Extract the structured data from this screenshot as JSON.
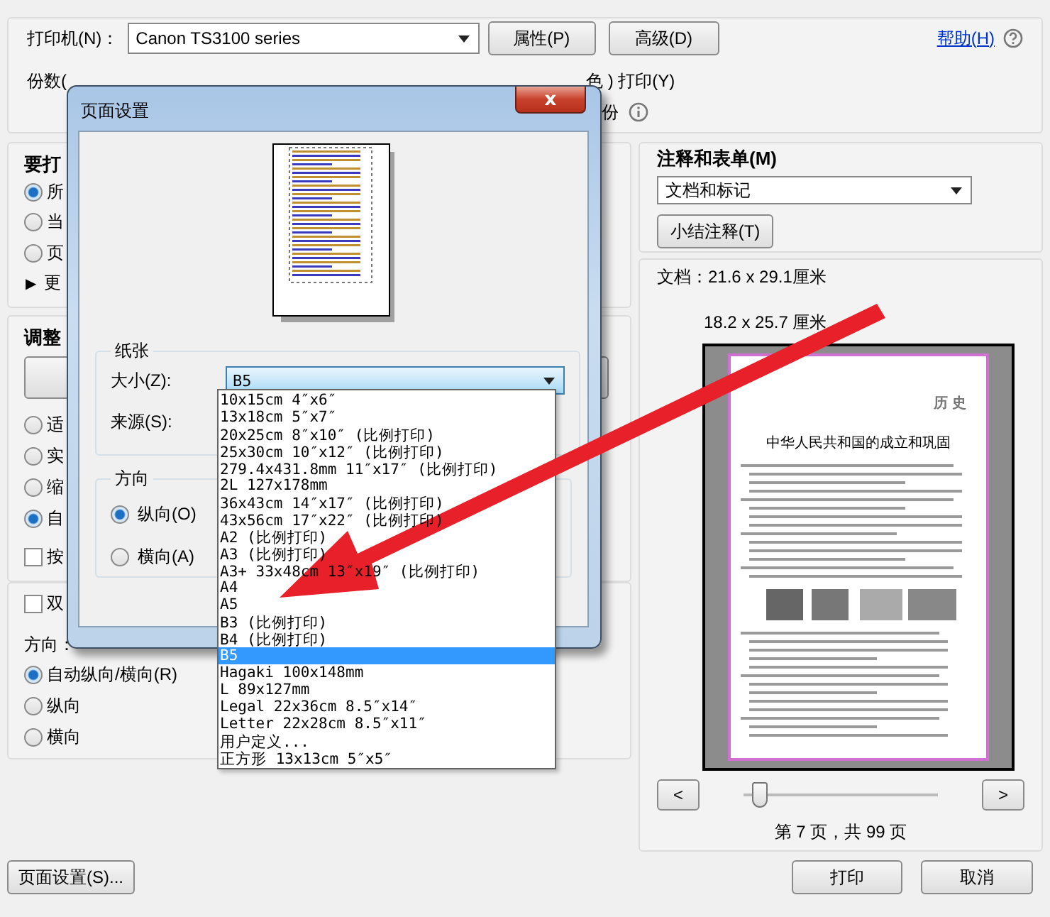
{
  "print_dialog": {
    "printer": {
      "label": "打印机(N)：",
      "value": "Canon TS3100 series"
    },
    "top_buttons": [
      "属性(P)",
      "高级(D)"
    ],
    "help_link": "帮助(H)",
    "copies_label": "份数(",
    "grayscale_label": "色 ) 打印(Y)",
    "copies_suffix": "份",
    "pages_section": {
      "title": "要打",
      "options": [
        {
          "label": "所",
          "selected": true
        },
        {
          "label": "当",
          "selected": false
        },
        {
          "label": "页",
          "selected": false
        }
      ],
      "more_arrow": "▶",
      "more": "更"
    },
    "sizing_section": {
      "title": "调整",
      "options": [
        {
          "label": "适",
          "selected": false
        },
        {
          "label": "实",
          "selected": false
        },
        {
          "label": "缩",
          "selected": false
        },
        {
          "label": "自",
          "selected": true
        }
      ],
      "checkbox": {
        "label": "按",
        "checked": false
      }
    },
    "duplex": {
      "label": "双",
      "checked": false
    },
    "orientation": {
      "title": "方向：",
      "options": [
        {
          "label": "自动纵向/横向(R)",
          "selected": true
        },
        {
          "label": "纵向",
          "selected": false
        },
        {
          "label": "横向",
          "selected": false
        }
      ]
    },
    "comments": {
      "title": "注释和表单(M)",
      "value": "文档和标记",
      "button": "小结注释(T)"
    },
    "document_size": "文档：21.6 x 29.1厘米",
    "paper_size": "18.2 x 25.7 厘米",
    "preview_page": {
      "header": "历 史",
      "title": "中华人民共和国的成立和巩固"
    },
    "nav": {
      "prev": "<",
      "next": ">",
      "level": 0.08
    },
    "page_status": "第 7 页，共 99 页",
    "page_setup_button": "页面设置(S)...",
    "footer_buttons": [
      "打印",
      "取消"
    ]
  },
  "page_setup": {
    "title": "页面设置",
    "close": "x",
    "paper_group": "纸张",
    "size_label": "大小(Z):",
    "size_value": "B5",
    "source_label": "来源(S):",
    "orientation_group": "方向",
    "orientation_options": [
      {
        "label": "纵向(O)",
        "selected": true
      },
      {
        "label": "横向(A)",
        "selected": false
      }
    ],
    "size_options": [
      {
        "label": "10x15cm 4″x6″",
        "selected": false
      },
      {
        "label": "13x18cm 5″x7″",
        "selected": false
      },
      {
        "label": "20x25cm 8″x10″ (比例打印)",
        "selected": false
      },
      {
        "label": "25x30cm 10″x12″ (比例打印)",
        "selected": false
      },
      {
        "label": "279.4x431.8mm 11″x17″ (比例打印)",
        "selected": false
      },
      {
        "label": "2L 127x178mm",
        "selected": false
      },
      {
        "label": "36x43cm 14″x17″ (比例打印)",
        "selected": false
      },
      {
        "label": "43x56cm 17″x22″ (比例打印)",
        "selected": false
      },
      {
        "label": "A2 (比例打印)",
        "selected": false
      },
      {
        "label": "A3 (比例打印)",
        "selected": false
      },
      {
        "label": "A3+ 33x48cm 13″x19″ (比例打印)",
        "selected": false
      },
      {
        "label": "A4",
        "selected": false
      },
      {
        "label": "A5",
        "selected": false
      },
      {
        "label": "B3 (比例打印)",
        "selected": false
      },
      {
        "label": "B4 (比例打印)",
        "selected": false
      },
      {
        "label": "B5",
        "selected": true
      },
      {
        "label": "Hagaki 100x148mm",
        "selected": false
      },
      {
        "label": "L 89x127mm",
        "selected": false
      },
      {
        "label": "Legal 22x36cm 8.5″x14″",
        "selected": false
      },
      {
        "label": "Letter 22x28cm 8.5″x11″",
        "selected": false
      },
      {
        "label": "用户定义...",
        "selected": false
      },
      {
        "label": "正方形 13x13cm 5″x5″",
        "selected": false
      }
    ]
  }
}
